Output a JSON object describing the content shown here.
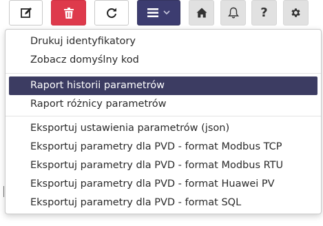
{
  "toolbar": {
    "buttons": [
      {
        "name": "edit",
        "icon": "edit-icon"
      },
      {
        "name": "delete",
        "icon": "trash-icon",
        "color": "#de3a4c"
      },
      {
        "name": "refresh",
        "icon": "refresh-icon"
      },
      {
        "name": "menu",
        "icon": "hamburger-menu-icon",
        "caret": "chevron-down-icon",
        "color": "#3c3c70"
      },
      {
        "name": "home",
        "icon": "home-icon"
      },
      {
        "name": "notifications",
        "icon": "bell-icon"
      },
      {
        "name": "help",
        "icon": "question-icon",
        "label": "?"
      },
      {
        "name": "settings",
        "icon": "gear-icon"
      }
    ]
  },
  "dropdown": {
    "groups": [
      {
        "items": [
          {
            "label": "Drukuj identyfikatory",
            "active": false
          },
          {
            "label": "Zobacz domyślny kod",
            "active": false
          }
        ]
      },
      {
        "items": [
          {
            "label": "Raport historii parametrów",
            "active": true
          },
          {
            "label": "Raport różnicy parametrów",
            "active": false
          }
        ]
      },
      {
        "items": [
          {
            "label": "Eksportuj ustawienia parametrów (json)",
            "active": false
          },
          {
            "label": "Eksportuj parametry dla PVD - format Modbus TCP",
            "active": false
          },
          {
            "label": "Eksportuj parametry dla PVD - format Modbus RTU",
            "active": false
          },
          {
            "label": "Eksportuj parametry dla PVD - format Huawei PV",
            "active": false
          },
          {
            "label": "Eksportuj parametry dla PVD - format SQL",
            "active": false
          }
        ]
      }
    ],
    "active_color": "#3c3c62"
  }
}
